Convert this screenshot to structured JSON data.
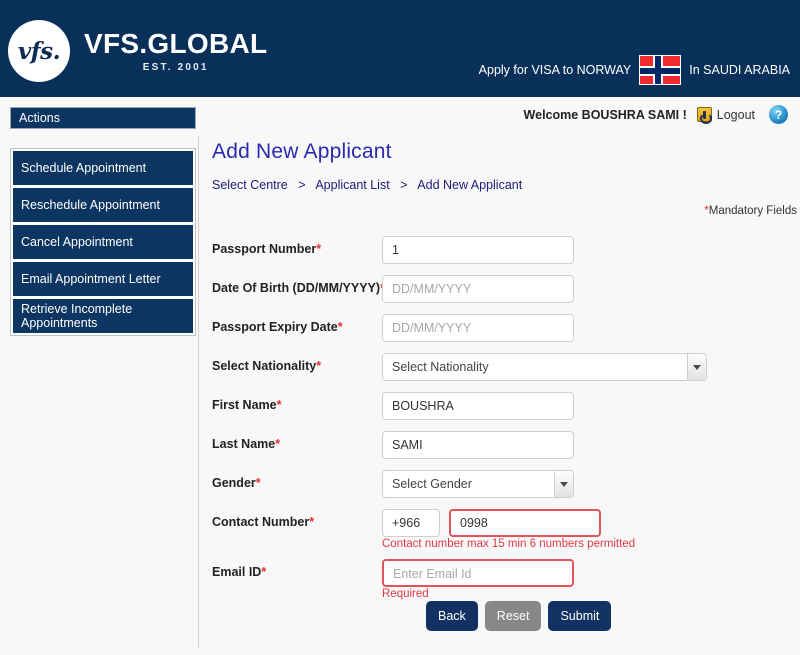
{
  "header": {
    "logo_mark": "vfs.",
    "logo_name": "VFS.GLOBAL",
    "logo_est": "EST. 2001",
    "apply_prefix": "Apply for VISA to NORWAY",
    "apply_suffix": "In SAUDI ARABIA",
    "flag_icon": "norway-flag-icon"
  },
  "welcome": {
    "text": "Welcome BOUSHRA SAMI !",
    "logout_label": "Logout",
    "logout_icon": "power-icon",
    "help_icon": "help-question-icon",
    "help_glyph": "?"
  },
  "sidebar": {
    "header": "Actions",
    "items": [
      {
        "label": "Schedule Appointment"
      },
      {
        "label": "Reschedule Appointment"
      },
      {
        "label": "Cancel Appointment"
      },
      {
        "label": "Email Appointment Letter"
      },
      {
        "label": "Retrieve Incomplete Appointments"
      }
    ]
  },
  "main": {
    "title": "Add New Applicant",
    "breadcrumb": [
      "Select Centre",
      "Applicant List",
      "Add New Applicant"
    ],
    "breadcrumb_separator": ">",
    "mandatory_note": "Mandatory Fields",
    "mandatory_star": "*"
  },
  "form": {
    "passport_number": {
      "label": "Passport Number",
      "star": "*",
      "value": "1"
    },
    "date_of_birth": {
      "label": "Date Of Birth (DD/MM/YYYY)",
      "star": "*",
      "placeholder": "DD/MM/YYYY"
    },
    "passport_expiry": {
      "label": "Passport Expiry Date",
      "star": "*",
      "placeholder": "DD/MM/YYYY"
    },
    "nationality": {
      "label": "Select Nationality",
      "star": "*",
      "selected": "Select Nationality"
    },
    "first_name": {
      "label": "First Name",
      "star": "*",
      "value": "BOUSHRA"
    },
    "last_name": {
      "label": "Last Name",
      "star": "*",
      "value": "SAMI"
    },
    "gender": {
      "label": "Gender",
      "star": "*",
      "selected": "Select Gender"
    },
    "contact_number": {
      "label": "Contact Number",
      "star": "*",
      "country_code": "+966",
      "value": "0998",
      "error": "Contact number max 15 min 6 numbers permitted"
    },
    "email": {
      "label": "Email ID",
      "star": "*",
      "placeholder": "Enter Email Id",
      "error": "Required"
    }
  },
  "buttons": {
    "back": "Back",
    "reset": "Reset",
    "submit": "Submit"
  },
  "colors": {
    "navy": "#093059",
    "menu_navy": "#0d3562",
    "title_blue": "#2a2ab0",
    "error_red": "#e03b45",
    "reset_gray": "#878787"
  }
}
